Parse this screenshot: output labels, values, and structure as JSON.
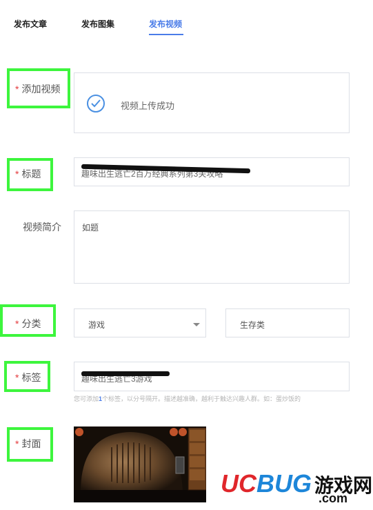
{
  "tabs": [
    {
      "label": "发布文章"
    },
    {
      "label": "发布图集"
    },
    {
      "label": "发布视频"
    }
  ],
  "required_mark": "*",
  "form": {
    "video": {
      "label": "添加视频",
      "status": "视频上传成功"
    },
    "title": {
      "label": "标题",
      "value": "趣味出生逃亡2百万经典系列第3关攻略"
    },
    "intro": {
      "label": "视频简介",
      "value": "如题"
    },
    "category": {
      "label": "分类",
      "primary": "游戏",
      "secondary": "生存类"
    },
    "tags": {
      "label": "标签",
      "value": "趣味出生逃亡3游戏",
      "hint_prefix": "您可添加",
      "hint_count": "1",
      "hint_suffix": "个标签，以分号隔开。描述越准确，越利于触达兴趣人群。如：蛋炒饭的"
    },
    "cover": {
      "label": "封面"
    }
  },
  "watermark": {
    "brand": "UCBUG",
    "suffix": "游戏网",
    "domain": ".com"
  },
  "colors": {
    "accent": "#4a7ce8",
    "highlight": "#3df53d",
    "required": "#e4393c"
  }
}
